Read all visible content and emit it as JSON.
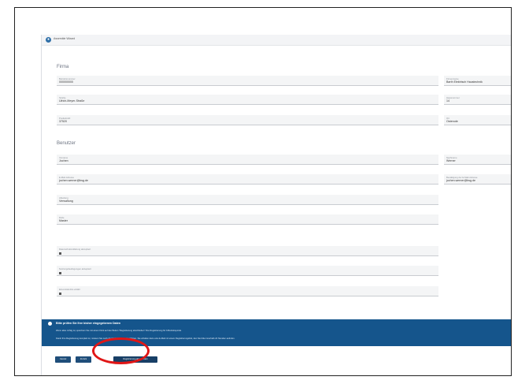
{
  "header": {
    "title": "Assemble Wizard"
  },
  "firma": {
    "section_title": "Firma",
    "fields": [
      {
        "label": "Betriebsnummer",
        "value": "000000000"
      },
      {
        "label": "Firmenname",
        "value": "Barth Elektrisch Haustechnik"
      },
      {
        "label": "Straße",
        "value": "Ulrich-Meyer-Straße"
      },
      {
        "label": "Hausnummer",
        "value": "14"
      },
      {
        "label": "Postleitzahl",
        "value": "37520"
      },
      {
        "label": "Ort",
        "value": "Osterode"
      }
    ]
  },
  "benutzer": {
    "section_title": "Benutzer",
    "fields": [
      {
        "label": "Vorname",
        "value": "Jochen"
      },
      {
        "label": "Nachname",
        "value": "Werner"
      },
      {
        "label": "E-Mail-Adresse",
        "value": "jochen.werner@bsg.de"
      },
      {
        "label": "Bestätigung der E-Mail-Adresse",
        "value": "jochen.werner@bsg.de"
      },
      {
        "label": "Abteilung",
        "value": "Verwaltung"
      },
      {
        "label": "Rolle",
        "value": "Master"
      },
      {
        "label": "Datenschutzerklärung akzeptiert"
      },
      {
        "label": "Nutzungsbedingungen akzeptiert"
      },
      {
        "label": "Einverständnis erklärt"
      }
    ]
  },
  "banner": {
    "title": "Bitte prüfen Sie Ihre bisher eingegebenen Daten",
    "line1": "Wenn alles richtig ist, speichern Sie mit einem Klick auf den Button \"Registrierung abschließen\" Ihre Registrierung für 0-Betriebsportal.",
    "line2": "Damit Ihre Registrierung komplett ist, müssen Sie noch die E-Mail-Adresse bestätigen. Sie erhalten dazu eine E-Mail mit einem Registrierungslink, den Sie bitte innerhalb 24 Stunden aufrufen."
  },
  "actions": {
    "cancel": "Cancel",
    "back": "Zurück",
    "finish": "Registrierung abschließen"
  },
  "colors": {
    "brand": "#15558c",
    "highlight": "#e01616"
  }
}
